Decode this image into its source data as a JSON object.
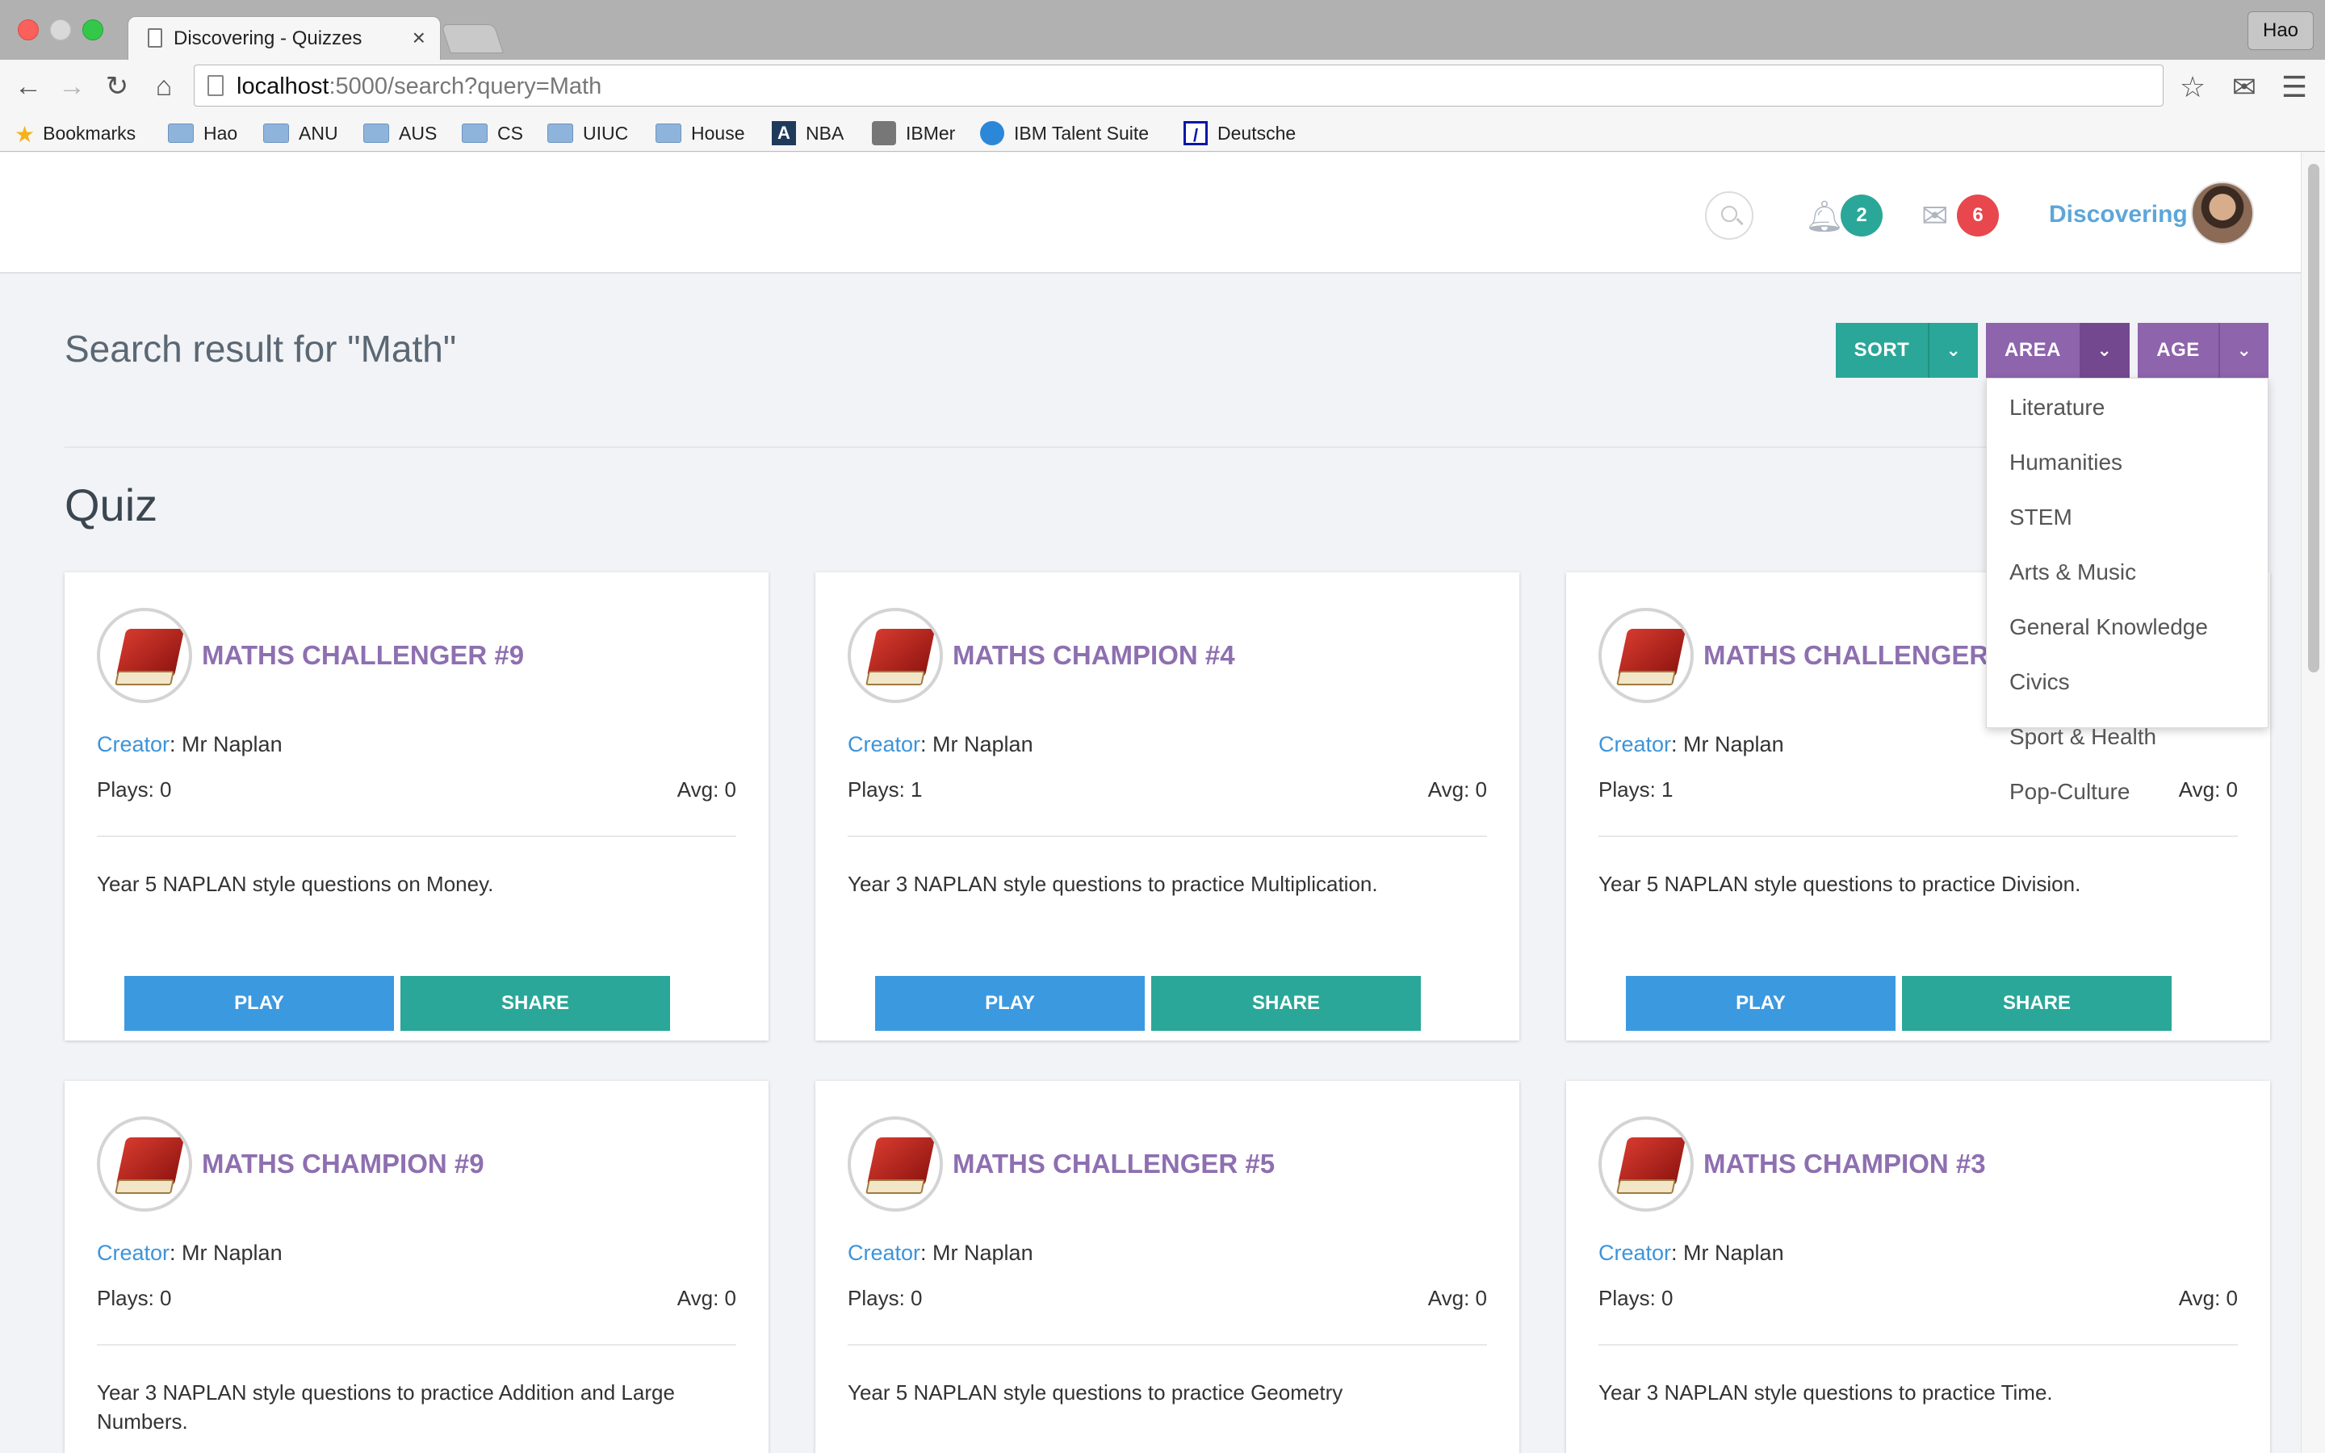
{
  "browser": {
    "tab_title": "Discovering - Quizzes",
    "tab_close": "×",
    "profile": "Hao",
    "url_host": "localhost",
    "url_path": ":5000/search?query=Math",
    "bookmarks": [
      {
        "label": "Bookmarks",
        "icon": "star-icon"
      },
      {
        "label": "Hao",
        "icon": "folder-icon"
      },
      {
        "label": "ANU",
        "icon": "folder-icon"
      },
      {
        "label": "AUS",
        "icon": "folder-icon"
      },
      {
        "label": "CS",
        "icon": "folder-icon"
      },
      {
        "label": "UIUC",
        "icon": "folder-icon"
      },
      {
        "label": "House",
        "icon": "folder-icon"
      },
      {
        "label": "NBA",
        "icon": "a-logo-icon"
      },
      {
        "label": "IBMer",
        "icon": "ibmer-icon"
      },
      {
        "label": "IBM Talent Suite",
        "icon": "bulb-icon"
      },
      {
        "label": "Deutsche",
        "icon": "deutsche-logo-icon"
      }
    ]
  },
  "header": {
    "notifications_count": "2",
    "messages_count": "6",
    "user_name": "Discovering"
  },
  "search": {
    "heading": "Search result for \"Math\""
  },
  "filters": {
    "sort_label": "SORT",
    "area_label": "AREA",
    "age_label": "AGE",
    "area_options": [
      "Literature",
      "Humanities",
      "STEM",
      "Arts & Music",
      "General Knowledge",
      "Civics",
      "Sport & Health",
      "Pop-Culture"
    ]
  },
  "section": {
    "title": "Quiz"
  },
  "labels": {
    "creator": "Creator",
    "play": "PLAY",
    "share": "SHARE"
  },
  "quizzes": [
    {
      "title": "MATHS CHALLENGER #9",
      "creator": "Mr Naplan",
      "plays": "Plays: 0",
      "avg": "Avg: 0",
      "description": "Year 5 NAPLAN style questions on Money."
    },
    {
      "title": "MATHS CHAMPION #4",
      "creator": "Mr Naplan",
      "plays": "Plays: 1",
      "avg": "Avg: 0",
      "description": "Year 3 NAPLAN style questions to practice Multiplication."
    },
    {
      "title": "MATHS CHALLENGER #",
      "creator": "Mr Naplan",
      "plays": "Plays: 1",
      "avg": "Avg: 0",
      "description": "Year 5 NAPLAN style questions to practice Division."
    },
    {
      "title": "MATHS CHAMPION #9",
      "creator": "Mr Naplan",
      "plays": "Plays: 0",
      "avg": "Avg: 0",
      "description": "Year 3 NAPLAN style questions to practice Addition and Large Numbers."
    },
    {
      "title": "MATHS CHALLENGER #5",
      "creator": "Mr Naplan",
      "plays": "Plays: 0",
      "avg": "Avg: 0",
      "description": "Year 5 NAPLAN style questions to practice Geometry"
    },
    {
      "title": "MATHS CHAMPION #3",
      "creator": "Mr Naplan",
      "plays": "Plays: 0",
      "avg": "Avg: 0",
      "description": "Year 3 NAPLAN style questions to practice Time."
    }
  ],
  "colors": {
    "teal": "#2aa798",
    "purple": "#8e64ad",
    "blue": "#3b99e0",
    "title_purple": "#8e6fb0",
    "badge_red": "#e8474e"
  }
}
